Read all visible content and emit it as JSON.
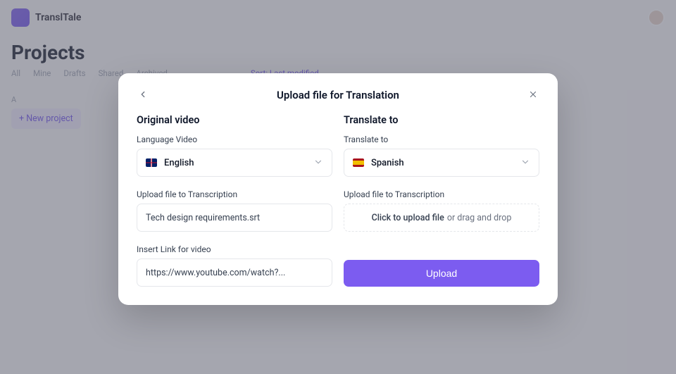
{
  "header": {
    "product_name": "TranslTale"
  },
  "bg": {
    "page_title": "Projects",
    "tabs": [
      "All",
      "Mine",
      "Drafts",
      "Shared",
      "Archived"
    ],
    "filter": "Sort: Last modified",
    "side_label": "A",
    "new_project": "+ New project"
  },
  "modal": {
    "title": "Upload file for Translation",
    "left": {
      "section": "Original video",
      "lang_label": "Language Video",
      "lang_value": "English",
      "upload_label": "Upload file to Transcription",
      "file_value": "Tech design requirements.srt",
      "link_label": "Insert Link for video",
      "link_value": "https://www.youtube.com/watch?..."
    },
    "right": {
      "section": "Translate to",
      "lang_label": "Translate to",
      "lang_value": "Spanish",
      "upload_label": "Upload file to Transcription",
      "dropzone_lead": "Click to upload file",
      "dropzone_rest": "or drag and drop",
      "submit": "Upload"
    }
  }
}
